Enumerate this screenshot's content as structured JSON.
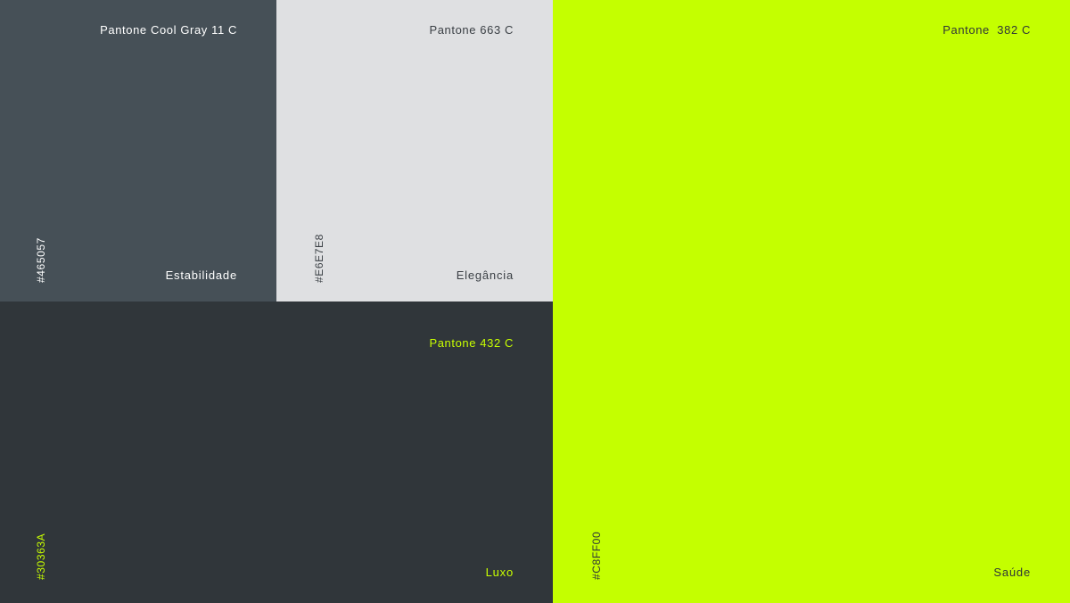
{
  "swatches": [
    {
      "pantone": "Pantone Cool Gray 11 C",
      "hex": "#465057",
      "meaning": "Estabilidade",
      "color": "#465057",
      "text_color": "#ffffff"
    },
    {
      "pantone": "Pantone 663 C",
      "hex": "#E6E7E8",
      "meaning": "Elegância",
      "color": "#dfe0e2",
      "text_color": "#3a3f44"
    },
    {
      "pantone": "Pantone 432 C",
      "hex": "#30363A",
      "meaning": "Luxo",
      "color": "#30363a",
      "text_color": "#c8ff00"
    },
    {
      "pantone": "Pantone  382 C",
      "hex": "#C8FF00",
      "meaning": "Saúde",
      "color": "#c4ff00",
      "text_color": "#2f3538"
    }
  ]
}
